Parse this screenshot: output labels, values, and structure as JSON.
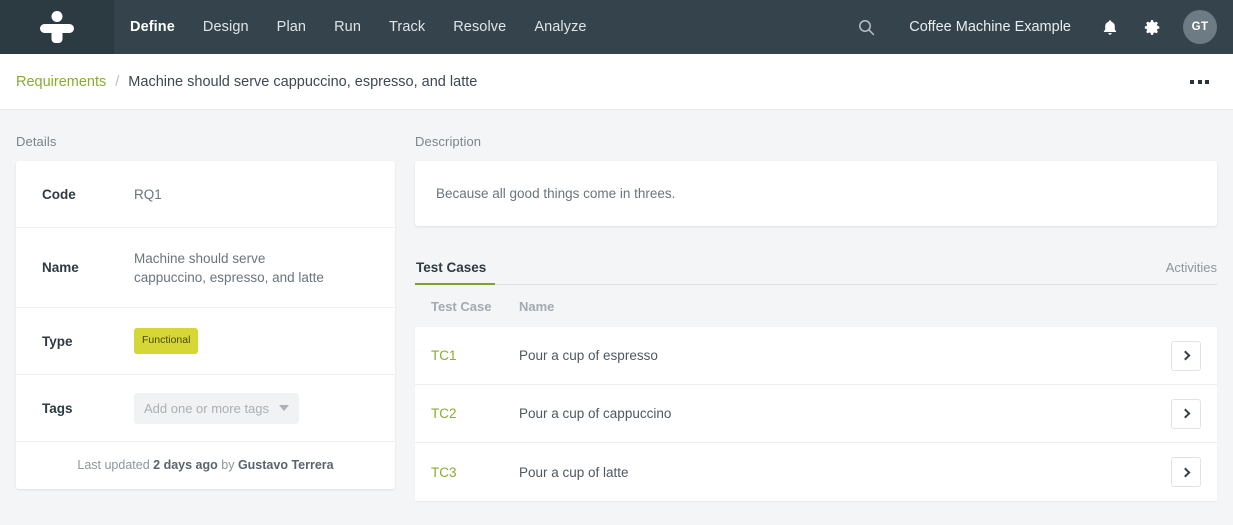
{
  "topnav": {
    "logo_icon": "tricentis-person-logo",
    "items": [
      {
        "label": "Define",
        "active": true
      },
      {
        "label": "Design",
        "active": false
      },
      {
        "label": "Plan",
        "active": false
      },
      {
        "label": "Run",
        "active": false
      },
      {
        "label": "Track",
        "active": false
      },
      {
        "label": "Resolve",
        "active": false
      },
      {
        "label": "Analyze",
        "active": false
      }
    ],
    "search_icon": "search-icon",
    "project_name": "Coffee Machine Example",
    "notifications_icon": "bell-icon",
    "settings_icon": "gear-icon",
    "avatar_initials": "GT"
  },
  "breadcrumb": {
    "parent": "Requirements",
    "separator": "/",
    "current": "Machine should serve cappuccino, espresso, and latte",
    "more_menu_icon": "ellipsis-icon"
  },
  "details": {
    "section_label": "Details",
    "rows": [
      {
        "key": "Code",
        "value": "RQ1"
      },
      {
        "key": "Name",
        "value": "Machine should serve cappuccino, espresso, and latte"
      },
      {
        "key": "Type",
        "value": "Functional"
      },
      {
        "key": "Tags",
        "value": ""
      }
    ],
    "type_badge": "Functional",
    "tags_placeholder": "Add one or more tags",
    "footer": {
      "prefix": "Last updated",
      "when": "2 days ago",
      "by": "by",
      "user": "Gustavo Terrera"
    }
  },
  "description": {
    "section_label": "Description",
    "text": "Because all good things come in threes."
  },
  "tabs": {
    "items": [
      {
        "label": "Test Cases",
        "active": true
      }
    ],
    "right_label": "Activities"
  },
  "test_cases_table": {
    "columns": [
      "Test Case",
      "Name"
    ],
    "rows": [
      {
        "code": "TC1",
        "name": "Pour a cup of espresso",
        "action_icon": "chevron-right-icon"
      },
      {
        "code": "TC2",
        "name": "Pour a cup of cappuccino",
        "action_icon": "chevron-right-icon"
      },
      {
        "code": "TC3",
        "name": "Pour a cup of latte",
        "action_icon": "chevron-right-icon"
      }
    ]
  },
  "colors": {
    "nav_bg": "#35444c",
    "logo_bg": "#2c3b42",
    "accent_green": "#7ba428",
    "link_green": "#86ae2d",
    "badge_yellow": "#d6d636",
    "page_bg": "#f4f5f6"
  }
}
